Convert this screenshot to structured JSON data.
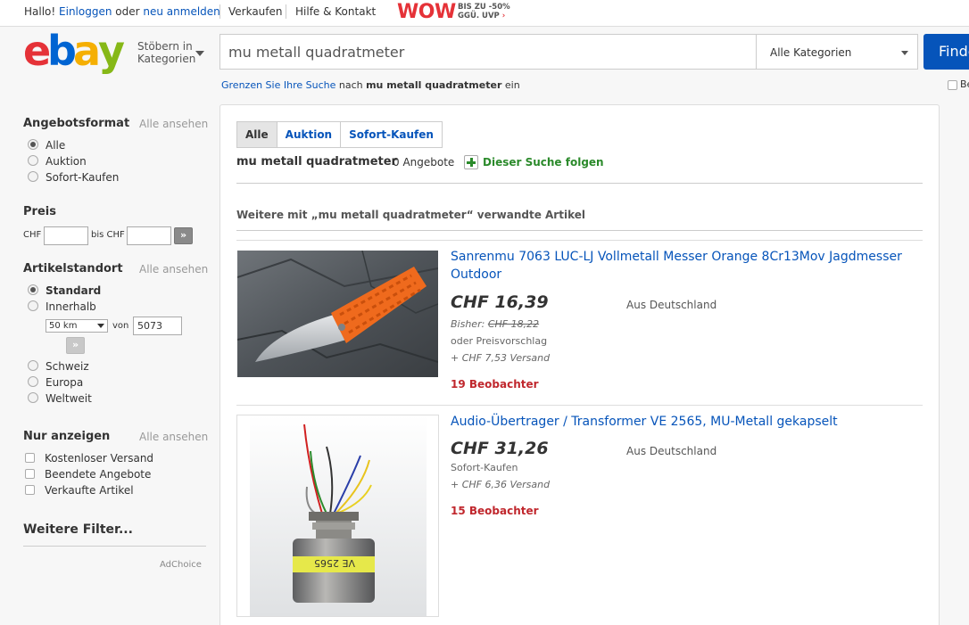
{
  "topbar": {
    "greeting": "Hallo!",
    "login": "Einloggen",
    "or": "oder",
    "register": "neu anmelden",
    "sell": "Verkaufen",
    "help": "Hilfe & Kontakt",
    "wow": "WOW",
    "wow_sub1": "BIS ZU -50%",
    "wow_sub2": "GGÜ. UVP",
    "wow_arrow": "›"
  },
  "header": {
    "logo_letters": [
      "e",
      "b",
      "a",
      "y"
    ],
    "logo_colors": [
      "#e53238",
      "#0064d2",
      "#f5af02",
      "#86b817"
    ],
    "shop_by_line1": "Stöbern in",
    "shop_by_line2": "Kategorien",
    "search_value": "mu metall quadratmeter",
    "category": "Alle Kategorien",
    "find_button": "Finden",
    "refine_link": "Grenzen Sie Ihre Suche",
    "refine_mid": "nach",
    "refine_query": "mu metall quadratmeter",
    "refine_end": "ein",
    "right_check_label": "Be"
  },
  "sidebar": {
    "format": {
      "title": "Angebotsformat",
      "see_all": "Alle ansehen",
      "options": [
        "Alle",
        "Auktion",
        "Sofort-Kaufen"
      ],
      "selected": 0
    },
    "price": {
      "title": "Preis",
      "currency": "CHF",
      "to_label": "bis CHF",
      "from_value": "",
      "to_value": "",
      "go": "»"
    },
    "location": {
      "title": "Artikelstandort",
      "see_all": "Alle ansehen",
      "standard": "Standard",
      "within": "Innerhalb",
      "radius": "50 km",
      "of_label": "von",
      "zip": "5073",
      "go": "»",
      "regions": [
        "Schweiz",
        "Europa",
        "Weltweit"
      ]
    },
    "show_only": {
      "title": "Nur anzeigen",
      "see_all": "Alle ansehen",
      "options": [
        "Kostenloser Versand",
        "Beendete Angebote",
        "Verkaufte Artikel"
      ]
    },
    "more_filters": "Weitere Filter...",
    "adchoice": "AdChoice"
  },
  "results": {
    "tabs": [
      "Alle",
      "Auktion",
      "Sofort-Kaufen"
    ],
    "active_tab": 0,
    "query": "mu metall quadratmeter",
    "count": "0 Angebote",
    "follow": "Dieser Suche folgen",
    "related_heading": "Weitere mit „mu metall quadratmeter“ verwandte Artikel",
    "items": [
      {
        "title_line1": "Sanrenmu 7063 LUC-LJ Vollmetall Messer Orange 8Cr13Mov Jagdmesser",
        "title_line2": "Outdoor",
        "price": "CHF 16,39",
        "location": "Aus Deutschland",
        "was_label": "Bisher:",
        "was_price": "CHF 18,22",
        "offer": "oder Preisvorschlag",
        "shipping": "+ CHF 7,53 Versand",
        "watchers": "19 Beobachter"
      },
      {
        "title_line1": "Audio-Übertrager / Transformer VE 2565, MU-Metall gekapselt",
        "price": "CHF 31,26",
        "location": "Aus Deutschland",
        "buy_now": "Sofort-Kaufen",
        "shipping": "+ CHF 6,36 Versand",
        "watchers": "15 Beobachter",
        "label_text": "VE 2565"
      }
    ]
  }
}
